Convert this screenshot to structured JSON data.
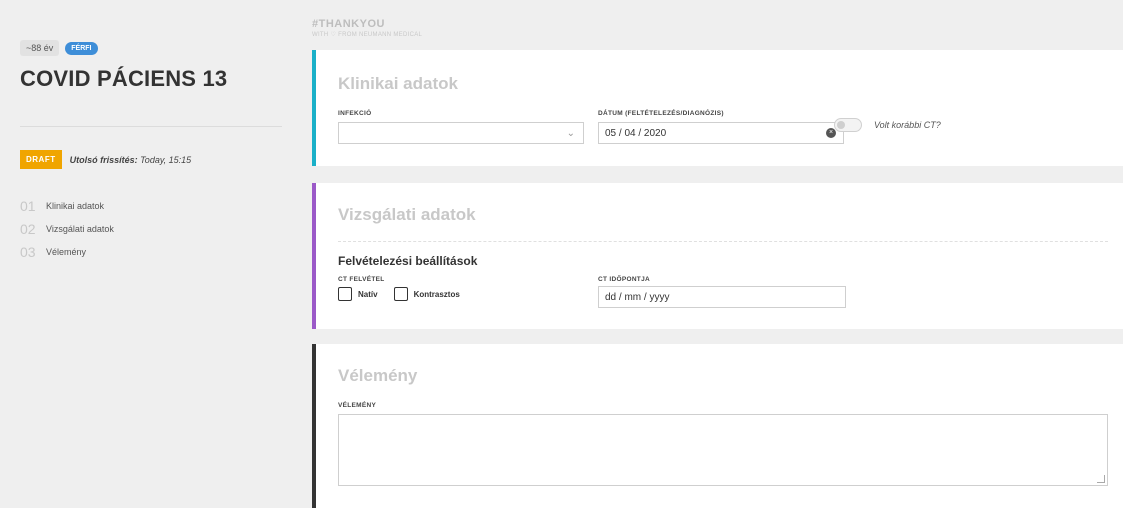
{
  "sidebar": {
    "age": "~88 év",
    "gender": "FÉRFI",
    "patient_title": "COVID PÁCIENS 13",
    "status_badge": "DRAFT",
    "updated_label": "Utolsó frissítés:",
    "updated_value": "Today, 15:15",
    "nav": [
      {
        "num": "01",
        "label": "Klinikai adatok"
      },
      {
        "num": "02",
        "label": "Vizsgálati adatok"
      },
      {
        "num": "03",
        "label": "Vélemény"
      }
    ]
  },
  "header": {
    "title": "#THANKYOU",
    "subtitle": "WITH ♡ FROM NEUMANN MEDICAL"
  },
  "clinical": {
    "title": "Klinikai adatok",
    "infection_label": "INFEKCIÓ",
    "infection_value": "",
    "date_label": "DÁTUM (FELTÉTELEZÉS/DIAGNÓZIS)",
    "date_value": "05 / 04 / 2020",
    "toggle_label": "Volt korábbi CT?",
    "toggle_on": false
  },
  "exam": {
    "title": "Vizsgálati adatok",
    "subheading": "Felvételezési beállítások",
    "ct_label": "CT FELVÉTEL",
    "options": [
      "Natív",
      "Kontrasztos"
    ],
    "ct_time_label": "CT IDŐPONTJA",
    "ct_time_placeholder": "dd / mm / yyyy"
  },
  "opinion": {
    "title": "Vélemény",
    "field_label": "VÉLEMÉNY",
    "value": ""
  },
  "colors": {
    "clinical_accent": "#1ab0c8",
    "exam_accent": "#9b59c8",
    "opinion_accent": "#333333",
    "draft": "#f0a500",
    "gender_badge": "#3e8ed8"
  }
}
